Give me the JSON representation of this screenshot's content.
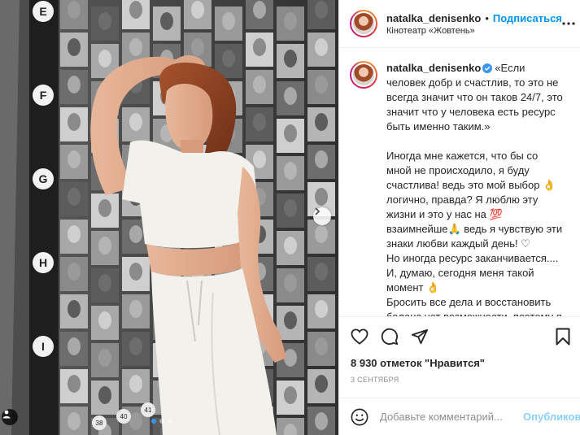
{
  "post": {
    "username": "natalka_denisenko",
    "follow_label": "Подписаться",
    "location": "Кінотеатр «Жовтень»",
    "separator": "•",
    "caption_lines": [
      "«Если человек добр и счастлив, то это не всегда значит что он таков 24/7, это значит что у человека есть ресурс быть именно таким.»",
      "",
      "Иногда мне кажется, что бы со мной не происходило, я буду счастлива! ведь это мой выбор 👌 логично, правда? Я люблю эту жизни и это у нас на 💯 взаимнейше🙏 ведь я чувствую эти знаки любви каждый день! ♡",
      "Но иногда ресурс заканчивается....",
      "И, думаю, сегодня меня такой момент 👌",
      "Бросить все дела и восстановить баланс нет возможности, поэтому я просто позволяю себя сегодня пострадать..."
    ],
    "likes": "8 930 отметок \"Нравится\"",
    "date": "3 сентября",
    "comment_placeholder": "Добавьте комментарий...",
    "publish_label": "Опубликовать"
  },
  "photo": {
    "wall_letters": [
      "E",
      "F",
      "G",
      "H",
      "I"
    ],
    "seat_numbers": [
      "38",
      "40",
      "41"
    ],
    "carousel": {
      "total": 3,
      "active": 1
    }
  },
  "colors": {
    "link_blue": "#0095f6",
    "dot_active": "#3897f0",
    "outfit": "#f3f1ec"
  },
  "icons": [
    "more-options-icon",
    "verified-badge-icon",
    "heart-icon",
    "comment-icon",
    "share-icon",
    "bookmark-icon",
    "emoji-icon",
    "chevron-right-icon",
    "user-tag-icon"
  ]
}
